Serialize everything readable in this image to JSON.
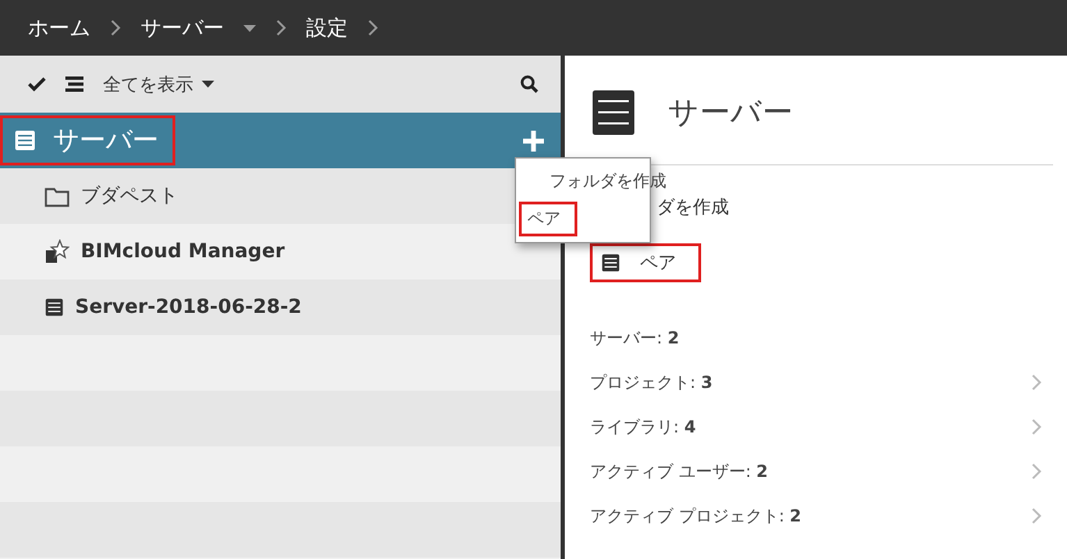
{
  "breadcrumbs": [
    {
      "label": "ホーム",
      "dropdown": false
    },
    {
      "label": "サーバー",
      "dropdown": true
    },
    {
      "label": "設定",
      "dropdown": false
    }
  ],
  "toolbar": {
    "filter": "全てを表示"
  },
  "tree": {
    "header": {
      "label": "サーバー",
      "highlighted": true
    },
    "items": [
      {
        "kind": "folder",
        "label": "ブダペスト",
        "bold": false
      },
      {
        "kind": "manager",
        "label": "BIMcloud Manager",
        "bold": true
      },
      {
        "kind": "server",
        "label": "Server-2018-06-28-2",
        "bold": true
      }
    ]
  },
  "menu": {
    "items": [
      {
        "label": "フォルダを作成",
        "highlighted": false
      },
      {
        "label": "ペア",
        "highlighted": true
      }
    ]
  },
  "detail": {
    "title": "サーバー",
    "actions": [
      {
        "kind": "text",
        "label": "ダを作成",
        "highlighted": false
      },
      {
        "kind": "server",
        "label": "ペア",
        "highlighted": true
      }
    ],
    "stats": [
      {
        "label": "サーバー: **2**",
        "link": false
      },
      {
        "label": "プロジェクト: **3**",
        "link": true
      },
      {
        "label": "ライブラリ: **4**",
        "link": true
      },
      {
        "label": "アクティブ ユーザー: **2**",
        "link": true
      },
      {
        "label": "アクティブ プロジェクト: **2**",
        "link": true
      }
    ]
  }
}
